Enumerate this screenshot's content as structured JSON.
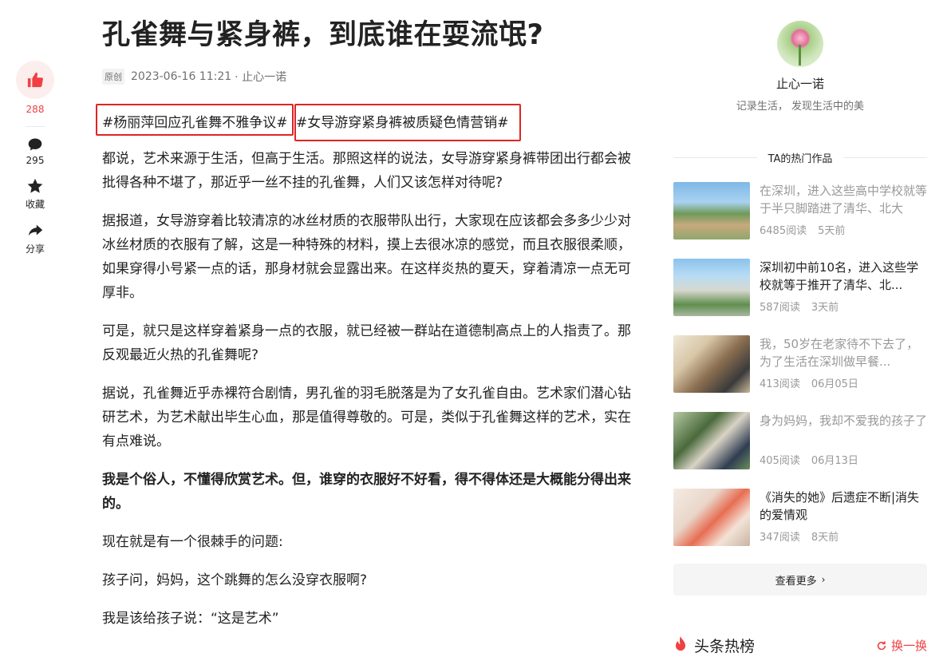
{
  "article": {
    "title": "孔雀舞与紧身裤，到底谁在耍流氓?",
    "badge": "原创",
    "date": "2023-06-16 11:21",
    "author": "· 止心一诺",
    "tag1": "#杨丽萍回应孔雀舞不雅争议#",
    "tag2": "#女导游穿紧身裤被质疑色情营销#",
    "paragraphs": [
      "都说，艺术来源于生活，但高于生活。那照这样的说法，女导游穿紧身裤带团出行都会被批得各种不堪了，那近乎一丝不挂的孔雀舞，人们又该怎样对待呢?",
      "据报道，女导游穿着比较清凉的冰丝材质的衣服带队出行，大家现在应该都会多多少少对冰丝材质的衣服有了解，这是一种特殊的材料，摸上去很冰凉的感觉，而且衣服很柔顺，如果穿得小号紧一点的话，那身材就会显露出来。在这样炎热的夏天，穿着清凉一点无可厚非。",
      "可是，就只是这样穿着紧身一点的衣服，就已经被一群站在道德制高点上的人指责了。那反观最近火热的孔雀舞呢?",
      "据说，孔雀舞近乎赤裸符合剧情，男孔雀的羽毛脱落是为了女孔雀自由。艺术家们潜心钻研艺术，为艺术献出毕生心血，那是值得尊敬的。可是，类似于孔雀舞这样的艺术，实在有点难说。",
      "我是个俗人，不懂得欣赏艺术。但，谁穿的衣服好不好看，得不得体还是大概能分得出来的。",
      "现在就是有一个很棘手的问题:",
      "孩子问，妈妈，这个跳舞的怎么没穿衣服啊?",
      "我是该给孩子说：“这是艺术”"
    ]
  },
  "rail": {
    "like_count": "288",
    "comment_count": "295",
    "collect_label": "收藏",
    "share_label": "分享"
  },
  "sidebar": {
    "name": "止心一诺",
    "bio": "记录生活， 发现生活中的美",
    "hot_works_title": "TA的热门作品",
    "works": [
      {
        "title": "在深圳，进入这些高中学校就等于半只脚踏进了清华、北大",
        "reads": "6485阅读",
        "time": "5天前"
      },
      {
        "title": "深圳初中前10名，进入这些学校就等于推开了清华、北...",
        "reads": "587阅读",
        "time": "3天前"
      },
      {
        "title": "我，50岁在老家待不下去了，为了生活在深圳做早餐...",
        "reads": "413阅读",
        "time": "06月05日"
      },
      {
        "title": "身为妈妈，我却不爱我的孩子了",
        "reads": "405阅读",
        "time": "06月13日"
      },
      {
        "title": "《消失的她》后遗症不断|消失的爱情观",
        "reads": "347阅读",
        "time": "8天前"
      }
    ],
    "more_label": "查看更多",
    "hotlist_title": "头条热榜",
    "refresh_label": "换一换"
  },
  "colors": {
    "accent": "#f04142",
    "highlight_border": "#e02424"
  }
}
